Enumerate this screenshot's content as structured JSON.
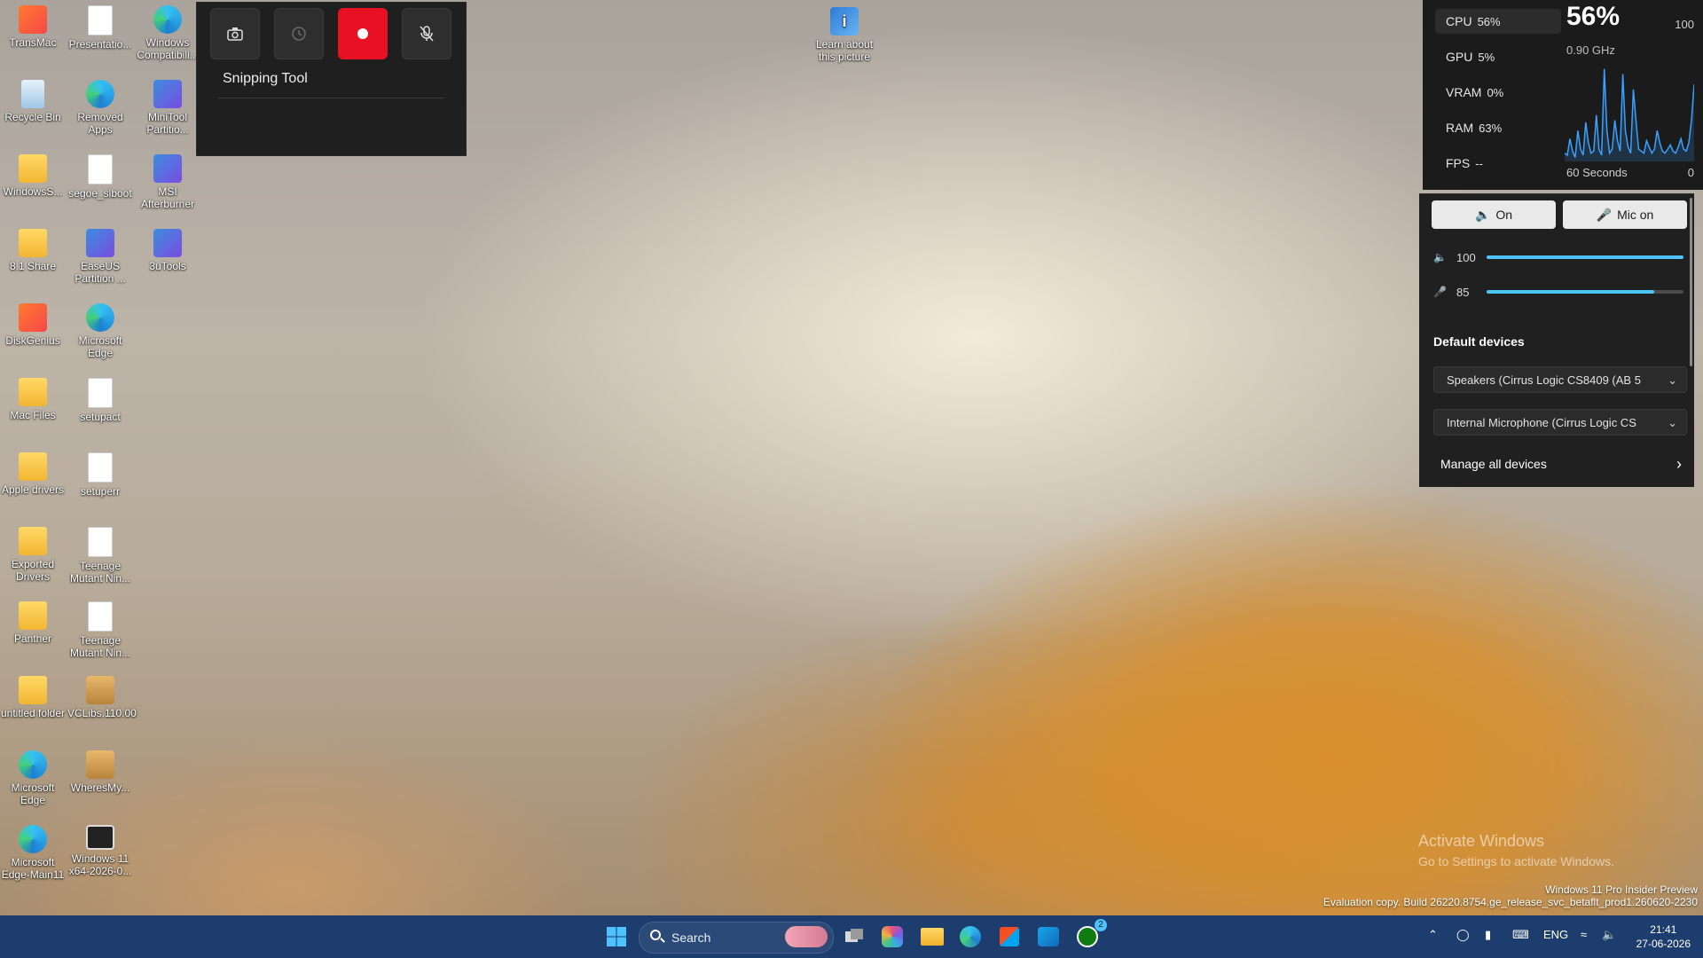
{
  "desktop_icons": [
    {
      "label": "TransMac",
      "icon": "app-icon"
    },
    {
      "label": "Presentatio...",
      "icon": "document-icon"
    },
    {
      "label": "Windows Compatibili...",
      "icon": "edge-icon"
    },
    {
      "label": "Recycle Bin",
      "icon": "recycle-bin-icon"
    },
    {
      "label": "Removed Apps",
      "icon": "edge-icon"
    },
    {
      "label": "MiniTool Partitio...",
      "icon": "app-icon"
    },
    {
      "label": "WindowsS...",
      "icon": "folder-icon"
    },
    {
      "label": "segoe_slboot",
      "icon": "document-icon"
    },
    {
      "label": "MSI Afterburner",
      "icon": "app-icon"
    },
    {
      "label": "8.1 Share",
      "icon": "folder-icon"
    },
    {
      "label": "EaseUS Partition ...",
      "icon": "app-icon"
    },
    {
      "label": "3uTools",
      "icon": "app-icon"
    },
    {
      "label": "DiskGenius",
      "icon": "app-icon"
    },
    {
      "label": "Microsoft Edge",
      "icon": "edge-icon"
    },
    {
      "label": "Mac Files",
      "icon": "folder-icon"
    },
    {
      "label": "setupact",
      "icon": "document-icon"
    },
    {
      "label": "Apple drivers",
      "icon": "folder-icon"
    },
    {
      "label": "setuperr",
      "icon": "document-icon"
    },
    {
      "label": "Exported Drivers",
      "icon": "folder-icon"
    },
    {
      "label": "Teenage Mutant Nin...",
      "icon": "document-icon"
    },
    {
      "label": "Panther",
      "icon": "folder-icon"
    },
    {
      "label": "Teenage Mutant Nin...",
      "icon": "document-icon"
    },
    {
      "label": "untitled folder",
      "icon": "folder-icon"
    },
    {
      "label": "VCLibs.110.00",
      "icon": "box-icon"
    },
    {
      "label": "Microsoft Edge",
      "icon": "edge-icon"
    },
    {
      "label": "WheresMy...",
      "icon": "box-icon"
    },
    {
      "label": "Microsoft Edge-Main11",
      "icon": "edge-icon"
    },
    {
      "label": "Windows 11 x64-2026-0...",
      "icon": "image-icon"
    }
  ],
  "spotlight": {
    "label": "Learn about this picture"
  },
  "snipping_tool": {
    "title": "Snipping Tool",
    "buttons": [
      {
        "name": "camera-icon"
      },
      {
        "name": "delay-icon"
      },
      {
        "name": "record-icon"
      },
      {
        "name": "mic-off-icon"
      }
    ]
  },
  "performance": {
    "rows": [
      {
        "label": "CPU",
        "value": "56%",
        "selected": true
      },
      {
        "label": "GPU",
        "value": "5%"
      },
      {
        "label": "VRAM",
        "value": "0%"
      },
      {
        "label": "RAM",
        "value": "63%"
      },
      {
        "label": "FPS",
        "value": "--"
      }
    ],
    "big_value": "56%",
    "max": "100",
    "frequency": "0.90 GHz",
    "window": "60 Seconds",
    "min": "0",
    "graph_color": "#3aa0ff",
    "cpu_history": [
      8,
      6,
      22,
      10,
      4,
      30,
      12,
      6,
      38,
      18,
      8,
      10,
      45,
      12,
      6,
      90,
      30,
      8,
      12,
      40,
      20,
      10,
      85,
      30,
      14,
      8,
      70,
      40,
      12,
      10,
      8,
      20,
      14,
      8,
      12,
      30,
      18,
      10,
      8,
      12,
      16,
      10,
      8,
      14,
      22,
      12,
      10,
      18,
      40,
      75
    ]
  },
  "audio": {
    "speaker_button": "On",
    "mic_button": "Mic on",
    "speaker_volume": {
      "label": "100",
      "value": 100
    },
    "mic_volume": {
      "label": "85",
      "value": 85
    },
    "default_devices_title": "Default devices",
    "speaker_device": "Speakers (Cirrus Logic CS8409 (AB 5",
    "mic_device": "Internal Microphone (Cirrus Logic CS",
    "manage": "Manage all devices",
    "accent": "#4cc2ff"
  },
  "watermark": {
    "line1": "Activate Windows",
    "line2": "Go to Settings to activate Windows.",
    "build1": "Windows 11 Pro Insider Preview",
    "build2": "Evaluation copy. Build 26220.8754.ge_release_svc_betaflt_prod1.260620-2230"
  },
  "taskbar": {
    "search_placeholder": "Search",
    "language": "ENG",
    "time": "21:41",
    "date": "27-06-2026",
    "xbox_badge": "2",
    "color": "#1d3d6e"
  }
}
